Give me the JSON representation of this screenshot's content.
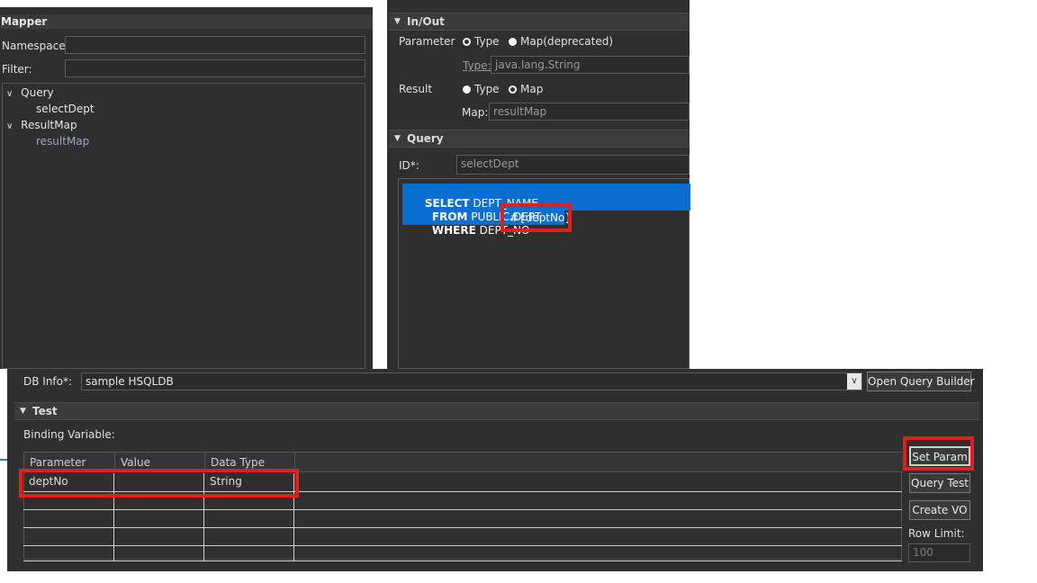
{
  "mapper": {
    "title": "Mapper",
    "namespace_label": "Namespace:",
    "namespace_value": "",
    "filter_label": "Filter:",
    "filter_value": "",
    "tree": {
      "query_label": "Query",
      "query_child": "selectDept",
      "resultmap_label": "ResultMap",
      "resultmap_child": "resultMap"
    }
  },
  "inout": {
    "title": "In/Out",
    "parameter_label": "Parameter",
    "param_opt_type": "Type",
    "param_opt_map": "Map(deprecated)",
    "type_link": "Type:",
    "type_value": "java.lang.String",
    "result_label": "Result",
    "result_opt_type": "Type",
    "result_opt_map": "Map",
    "map_label": "Map:",
    "map_value": "resultMap"
  },
  "query": {
    "title": "Query",
    "id_label": "ID*:",
    "id_value": "selectDept",
    "sql": {
      "line1_kw": "SELECT",
      "line1_rest": " DEPT_NAME",
      "line2_kw": "FROM",
      "line2_rest": " PUBLIC.DEPT",
      "line3_kw": "WHERE",
      "line3_rest": " DEPT_NO = ",
      "param_token": "#{deptNo}"
    }
  },
  "dbinfo": {
    "label": "DB Info*:",
    "value": "sample HSQLDB",
    "open_builder": "Open Query Builder"
  },
  "test": {
    "title": "Test",
    "binding_label": "Binding Variable:",
    "columns": [
      "Parameter",
      "Value",
      "Data Type"
    ],
    "rows": [
      {
        "parameter": "deptNo",
        "value": "",
        "datatype": "String"
      }
    ],
    "set_param": "Set Param",
    "query_test": "Query Test",
    "create_vo": "Create VO",
    "row_limit_label": "Row Limit:",
    "row_limit_value": "100"
  },
  "colors": {
    "panel_bg": "#2f2f2f",
    "selection": "#0a6fd0",
    "highlight_red": "#e0201e"
  }
}
